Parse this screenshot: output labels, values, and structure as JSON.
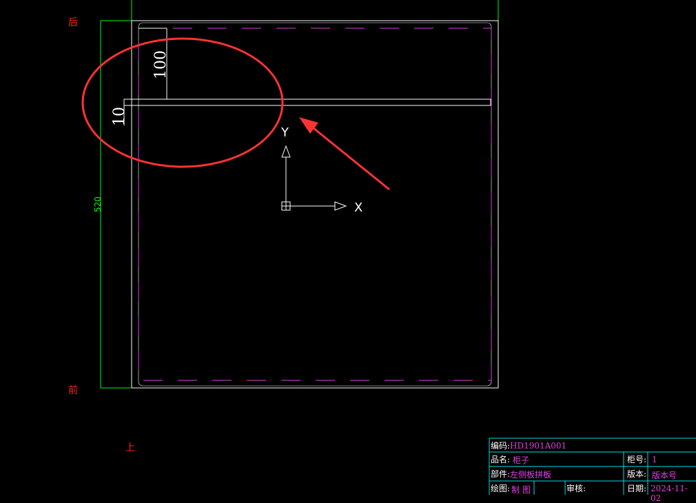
{
  "labels": {
    "back": "后",
    "front": "前",
    "top": "上"
  },
  "dimensions": {
    "depth": "520",
    "offset_100": "100",
    "thickness_10": "10"
  },
  "ucs": {
    "x_label": "X",
    "y_label": "Y"
  },
  "title_block": {
    "code_label": "编码:",
    "code_value": "HD1901A001",
    "product_label": "品名:",
    "product_value": "柜子",
    "cabinet_no_label": "柜号:",
    "cabinet_no_value": "1",
    "part_label": "部件:",
    "part_value": "左侧板拼板",
    "version_label": "版本:",
    "version_value": "版本号",
    "drawer_label": "绘图:",
    "drawer_value": "制 图",
    "reviewer_label": "审核:",
    "date_label": "日期:",
    "date_value": "2024-11-02"
  },
  "colors": {
    "background": "#000000",
    "outline": "#ffffff",
    "hidden_line": "#e040e0",
    "dimension_green": "#00ff00",
    "annotation_red": "#ff3333",
    "title_block_border": "#00e0e0",
    "annotation_label": "#ff2020"
  }
}
